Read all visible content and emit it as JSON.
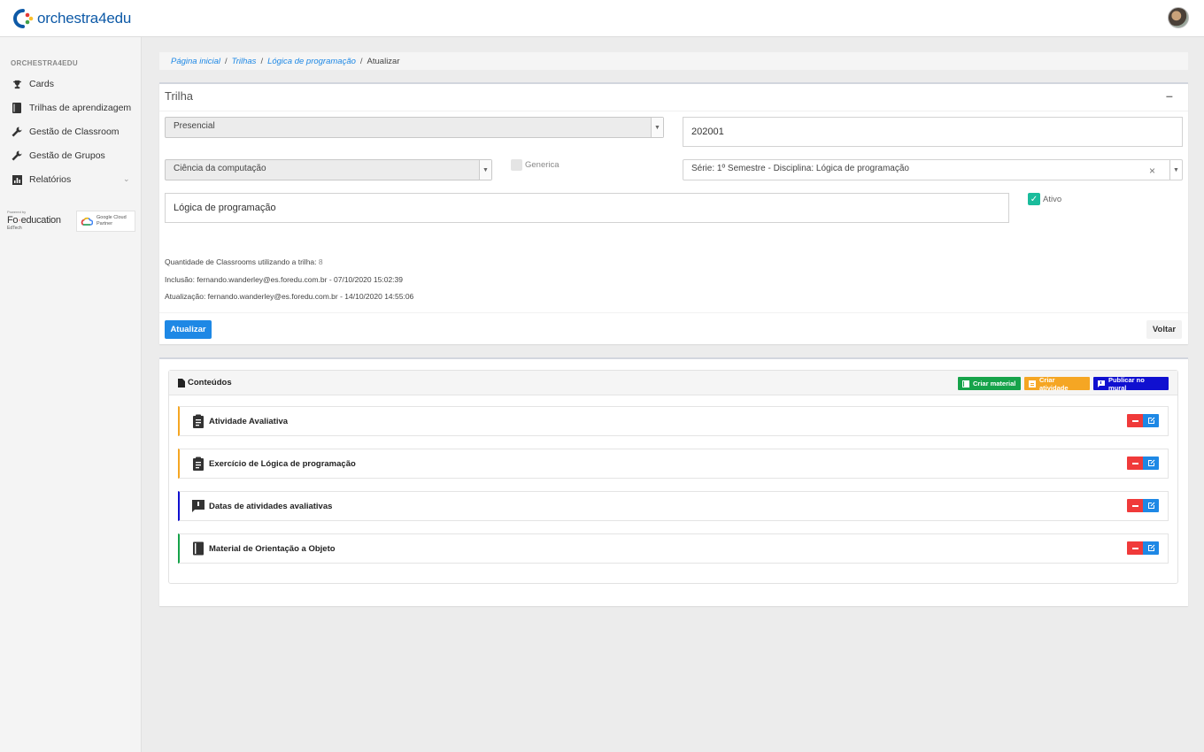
{
  "brand": {
    "name": "orchestra4edu",
    "colors": {
      "blue": "#0e5aa7",
      "red": "#e53935",
      "green": "#43a047",
      "yellow": "#fbc02d"
    }
  },
  "sidebar": {
    "heading": "ORCHESTRA4EDU",
    "items": [
      {
        "label": "Cards",
        "icon": "trophy-icon"
      },
      {
        "label": "Trilhas de aprendizagem",
        "icon": "book-icon"
      },
      {
        "label": "Gestão de Classroom",
        "icon": "wrench-icon"
      },
      {
        "label": "Gestão de Grupos",
        "icon": "wrench-icon"
      },
      {
        "label": "Relatórios",
        "icon": "bar-chart-icon"
      }
    ],
    "partners": {
      "powered_by": "Powered by",
      "foreducation_prefix": "Fo",
      "foreducation_suffix": "education",
      "edtech": "EdTech",
      "google_line1": "Google Cloud",
      "google_line2": "Partner"
    }
  },
  "breadcrumb": {
    "items": [
      "Página inicial",
      "Trilhas",
      "Lógica de programação"
    ],
    "current": "Atualizar"
  },
  "trilha": {
    "title": "Trilha",
    "modalidade": "Presencial",
    "codigo": "202001",
    "curso": "Ciência da computação",
    "generica_label": "Generica",
    "serie_disciplina": "Série: 1º Semestre - Disciplina: Lógica de programação",
    "nome": "Lógica de programação",
    "ativo_label": "Ativo",
    "classrooms_label": "Quantidade de Classrooms utilizando a trilha:",
    "classrooms_count": "8",
    "inclusao": "Inclusão: fernando.wanderley@es.foredu.com.br - 07/10/2020 15:02:39",
    "atualizacao": "Atualização: fernando.wanderley@es.foredu.com.br - 14/10/2020 14:55:06",
    "btn_atualizar": "Atualizar",
    "btn_voltar": "Voltar"
  },
  "conteudos": {
    "title": "Conteúdos",
    "btn_criar_material": "Criar material",
    "btn_criar_atividade": "Criar atividade",
    "btn_publicar_mural": "Publicar no mural",
    "items": [
      {
        "label": "Atividade Avaliativa",
        "type": "atividade",
        "color": "#f5a623"
      },
      {
        "label": "Exercício de Lógica de programação",
        "type": "atividade",
        "color": "#f5a623"
      },
      {
        "label": "Datas de atividades avaliativas",
        "type": "mural",
        "color": "#1010d0"
      },
      {
        "label": "Material de Orientação a Objeto",
        "type": "material",
        "color": "#16a34a"
      }
    ]
  }
}
